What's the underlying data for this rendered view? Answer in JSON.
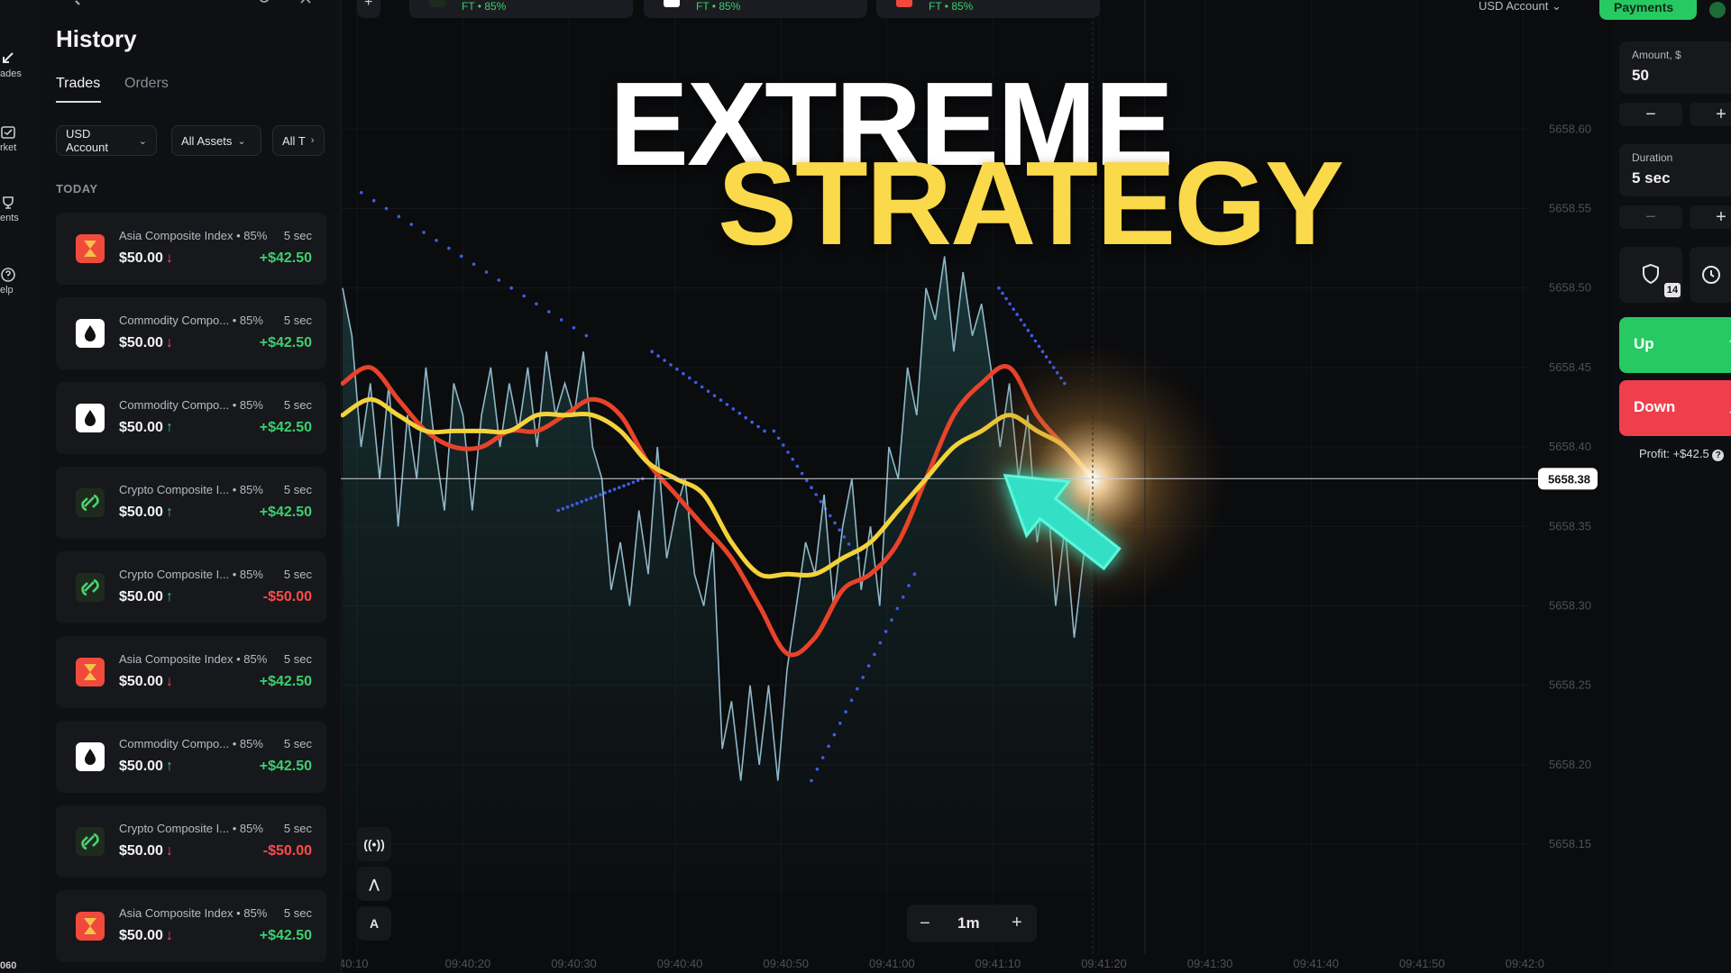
{
  "rail": {
    "items": [
      {
        "label": "ades",
        "icon": "trades-icon"
      },
      {
        "label": "rket",
        "icon": "market-icon"
      },
      {
        "label": "ents",
        "icon": "tournaments-icon"
      },
      {
        "label": "elp",
        "icon": "help-icon"
      }
    ],
    "bottom_text": "060"
  },
  "history": {
    "title": "History",
    "tabs": [
      "Trades",
      "Orders"
    ],
    "filters": [
      "USD Account",
      "All Assets",
      "All T"
    ],
    "section": "TODAY",
    "trades": [
      {
        "asset": "Asia Composite Index",
        "payout": "• 85%",
        "duration": "5 sec",
        "amount": "$50.00",
        "direction": "↓",
        "profit": "+$42.50",
        "result": "win",
        "icon": "asia-hourglass-icon",
        "icon_color": "#f04a3c"
      },
      {
        "asset": "Commodity Compo...",
        "payout": "• 85%",
        "duration": "5 sec",
        "amount": "$50.00",
        "direction": "↓",
        "profit": "+$42.50",
        "result": "win",
        "icon": "commodity-drop-icon",
        "icon_color": "#ffffff"
      },
      {
        "asset": "Commodity Compo...",
        "payout": "• 85%",
        "duration": "5 sec",
        "amount": "$50.00",
        "direction": "↑",
        "profit": "+$42.50",
        "result": "win",
        "icon": "commodity-drop-icon",
        "icon_color": "#ffffff"
      },
      {
        "asset": "Crypto Composite I...",
        "payout": "• 85%",
        "duration": "5 sec",
        "amount": "$50.00",
        "direction": "↑",
        "profit": "+$42.50",
        "result": "win",
        "icon": "crypto-link-icon",
        "icon_color": "#1f2a1e"
      },
      {
        "asset": "Crypto Composite I...",
        "payout": "• 85%",
        "duration": "5 sec",
        "amount": "$50.00",
        "direction": "↑",
        "profit": "-$50.00",
        "result": "loss",
        "icon": "crypto-link-icon",
        "icon_color": "#1f2a1e"
      },
      {
        "asset": "Asia Composite Index",
        "payout": "• 85%",
        "duration": "5 sec",
        "amount": "$50.00",
        "direction": "↓",
        "profit": "+$42.50",
        "result": "win",
        "icon": "asia-hourglass-icon",
        "icon_color": "#f04a3c"
      },
      {
        "asset": "Commodity Compo...",
        "payout": "• 85%",
        "duration": "5 sec",
        "amount": "$50.00",
        "direction": "↑",
        "profit": "+$42.50",
        "result": "win",
        "icon": "commodity-drop-icon",
        "icon_color": "#ffffff"
      },
      {
        "asset": "Crypto Composite I...",
        "payout": "• 85%",
        "duration": "5 sec",
        "amount": "$50.00",
        "direction": "↓",
        "profit": "-$50.00",
        "result": "loss",
        "icon": "crypto-link-icon",
        "icon_color": "#1f2a1e"
      },
      {
        "asset": "Asia Composite Index",
        "payout": "• 85%",
        "duration": "5 sec",
        "amount": "$50.00",
        "direction": "↓",
        "profit": "+$42.50",
        "result": "win",
        "icon": "asia-hourglass-icon",
        "icon_color": "#f04a3c"
      }
    ]
  },
  "top_tabs": [
    {
      "label": "FT • 85%",
      "icon": "crypto-link-icon"
    },
    {
      "label": "FT • 85%",
      "icon": "commodity-drop-icon"
    },
    {
      "label": "FT • 85%",
      "icon": "asia-hourglass-icon"
    }
  ],
  "top_right": {
    "account": "USD Account",
    "payments": "Payments"
  },
  "headline": {
    "line1": "EXTREME",
    "line2": "STRATEGY"
  },
  "chart_data": {
    "type": "line",
    "y_ticks": [
      "5658.60",
      "5658.55",
      "5658.50",
      "5658.45",
      "5658.40",
      "5658.35",
      "5658.30",
      "5658.25",
      "5658.20",
      "5658.15"
    ],
    "x_ticks": [
      "40:10",
      "09:40:20",
      "09:40:30",
      "09:40:40",
      "09:40:50",
      "09:41:00",
      "09:41:10",
      "09:41:20",
      "09:41:30",
      "09:41:40",
      "09:41:50",
      "09:42:0"
    ],
    "ylim": [
      5658.12,
      5658.62
    ],
    "current_price": "5658.38",
    "timeframe": "1m",
    "series": [
      {
        "color": "#8fb8c8",
        "points": [
          [
            5658.5,
            5658.47,
            5658.4,
            5658.44,
            5658.38,
            5658.44,
            5658.35,
            5658.42,
            5658.38,
            5658.45,
            5658.4,
            5658.36,
            5658.44,
            5658.42
          ],
          [
            5658.36,
            5658.42,
            5658.45,
            5658.4,
            5658.44,
            5658.41,
            5658.45,
            5658.4,
            5658.46,
            5658.42,
            5658.44,
            5658.42,
            5658.46,
            5658.4
          ],
          [
            5658.38,
            5658.31,
            5658.34,
            5658.3,
            5658.36,
            5658.32,
            5658.4,
            5658.33,
            5658.36,
            5658.38,
            5658.32,
            5658.3,
            5658.34,
            5658.21
          ],
          [
            5658.24,
            5658.19,
            5658.25,
            5658.2,
            5658.25,
            5658.19,
            5658.26,
            5658.3,
            5658.34,
            5658.32,
            5658.37,
            5658.3,
            5658.35,
            5658.38
          ],
          [
            5658.31,
            5658.35,
            5658.3,
            5658.4,
            5658.38,
            5658.45,
            5658.42,
            5658.5,
            5658.48,
            5658.52,
            5658.46,
            5658.51,
            5658.47,
            5658.49
          ],
          [
            5658.45,
            5658.4,
            5658.44,
            5658.38,
            5658.42,
            5658.34,
            5658.38,
            5658.3,
            5658.35,
            5658.28,
            5658.33,
            5658.38
          ]
        ]
      },
      {
        "color": "#e8432a",
        "points": [
          5658.44,
          5658.45,
          5658.43,
          5658.41,
          5658.4,
          5658.4,
          5658.41,
          5658.41,
          5658.42,
          5658.43,
          5658.42,
          5658.39,
          5658.37,
          5658.35,
          5658.33,
          5658.3,
          5658.27,
          5658.28,
          5658.31,
          5658.32,
          5658.34,
          5658.38,
          5658.42,
          5658.44,
          5658.45,
          5658.42,
          5658.4,
          5658.38
        ]
      },
      {
        "color": "#f4d23a",
        "points": [
          5658.42,
          5658.43,
          5658.42,
          5658.41,
          5658.41,
          5658.41,
          5658.41,
          5658.42,
          5658.42,
          5658.42,
          5658.41,
          5658.39,
          5658.38,
          5658.37,
          5658.34,
          5658.32,
          5658.32,
          5658.32,
          5658.33,
          5658.34,
          5658.36,
          5658.38,
          5658.4,
          5658.41,
          5658.42,
          5658.41,
          5658.4,
          5658.38
        ]
      }
    ],
    "dots": {
      "color": "#3c5ee8",
      "segments": [
        [
          [
            0.2,
            5658.56
          ],
          [
            2.6,
            5658.47
          ]
        ],
        [
          [
            2.3,
            5658.36
          ],
          [
            3.2,
            5658.38
          ]
        ],
        [
          [
            3.3,
            5658.46
          ],
          [
            4.5,
            5658.41
          ]
        ],
        [
          [
            4.6,
            5658.41
          ],
          [
            5.5,
            5658.33
          ]
        ],
        [
          [
            5.0,
            5658.19
          ],
          [
            6.1,
            5658.32
          ]
        ],
        [
          [
            7.0,
            5658.5
          ],
          [
            7.7,
            5658.44
          ]
        ]
      ]
    }
  },
  "chart_tools": [
    {
      "name": "signals-tool",
      "glyph": "((•))",
      "icon": "broadcast-icon"
    },
    {
      "name": "indicator-tool",
      "glyph": "⋀",
      "icon": "indicator-icon"
    },
    {
      "name": "drawing-tool",
      "glyph": "A",
      "icon": "drawing-icon"
    }
  ],
  "zoom": {
    "minus": "−",
    "value": "1m",
    "plus": "+"
  },
  "trade_panel": {
    "amount_label": "Amount, $",
    "amount_value": "50",
    "duration_label": "Duration",
    "duration_value": "5 sec",
    "minus": "−",
    "plus": "+",
    "badge": "14",
    "up_label": "Up",
    "down_label": "Down",
    "up_arrow": "↑",
    "down_arrow": "↓",
    "profit": "Profit: +$42.5",
    "help": "?"
  },
  "colors": {
    "win": "#3ccf6e",
    "loss": "#ff4a4a",
    "up": "#27c963",
    "down": "#ef3f4c",
    "accent": "#33e0c6"
  }
}
